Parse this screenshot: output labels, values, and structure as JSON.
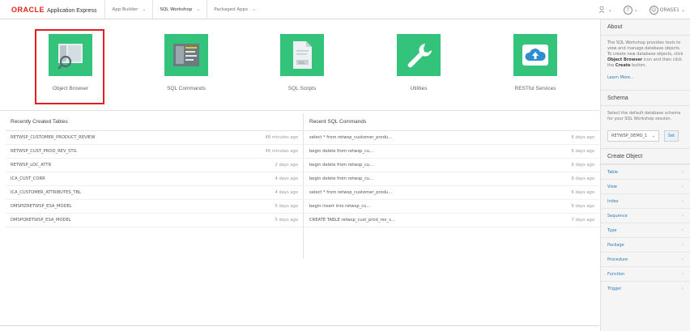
{
  "header": {
    "logo_brand": "ORACLE",
    "logo_product": "Application Express",
    "tabs": [
      {
        "label": "App Builder"
      },
      {
        "label": "SQL Workshop"
      },
      {
        "label": "Packaged Apps"
      }
    ],
    "user": "ORASE1"
  },
  "launch_items": [
    {
      "label": "Object Browser",
      "icon": "object-browser-icon"
    },
    {
      "label": "SQL Commands",
      "icon": "sql-commands-icon"
    },
    {
      "label": "SQL Scripts",
      "icon": "sql-scripts-icon"
    },
    {
      "label": "Utilities",
      "icon": "utilities-wrench-icon"
    },
    {
      "label": "RESTful Services",
      "icon": "restful-cloud-icon"
    }
  ],
  "recent_tables": {
    "title": "Recently Created Tables",
    "rows": [
      {
        "name": "RETWSP_CUSTOMER_PRODUCT_REVIEW",
        "time": "48 minutes ago"
      },
      {
        "name": "RETWSP_CUST_PROD_REV_STG",
        "time": "48 minutes ago"
      },
      {
        "name": "RETWSP_LOC_ATTR",
        "time": "2 days ago"
      },
      {
        "name": "ICA_CUST_CORR",
        "time": "4 days ago"
      },
      {
        "name": "ICA_CUSTOMER_ATTRIBUTES_TBL",
        "time": "4 days ago"
      },
      {
        "name": "DMSPIZRETWSP_ESA_MODEL",
        "time": "5 days ago"
      },
      {
        "name": "DMSPQRETWSP_ESA_MODEL",
        "time": "5 days ago"
      }
    ]
  },
  "recent_sql": {
    "title": "Recent SQL Commands",
    "rows": [
      {
        "name": "select * from retwsp_customer_produ...",
        "time": "6 days ago"
      },
      {
        "name": "begin delete from retwsp_cu...",
        "time": "6 days ago"
      },
      {
        "name": "begin delete from retwsp_cu...",
        "time": "6 days ago"
      },
      {
        "name": "begin delete from retwsp_cu...",
        "time": "6 days ago"
      },
      {
        "name": "select * from retwsp_customer_produ...",
        "time": "6 days ago"
      },
      {
        "name": "begin insert into retwsp_cu...",
        "time": "6 days ago"
      },
      {
        "name": "CREATE TABLE retwsp_cust_prod_rev_s...",
        "time": "7 days ago"
      }
    ]
  },
  "sidebar": {
    "about_title": "About",
    "about_text_1": "The SQL Workshop provides tools to view and manage database objects. To create new database objects, click ",
    "about_bold_1": "Object Browser",
    "about_text_2": " icon and then click the ",
    "about_bold_2": "Create",
    "about_text_3": " button.",
    "learn_more": "Learn More...",
    "schema_title": "Schema",
    "schema_text": "Select the default database schema for your SQL Workshop session.",
    "schema_value": "RETWSP_DEMO_1",
    "set_label": "Set",
    "create_title": "Create Object",
    "create_items": [
      "Table",
      "View",
      "Index",
      "Sequence",
      "Type",
      "Package",
      "Procedure",
      "Function",
      "Trigger"
    ]
  },
  "colors": {
    "tile_green": "#34c37a",
    "highlight_red": "#e02020",
    "oracle_red": "#e2231a",
    "link_blue": "#2a7ab8"
  }
}
